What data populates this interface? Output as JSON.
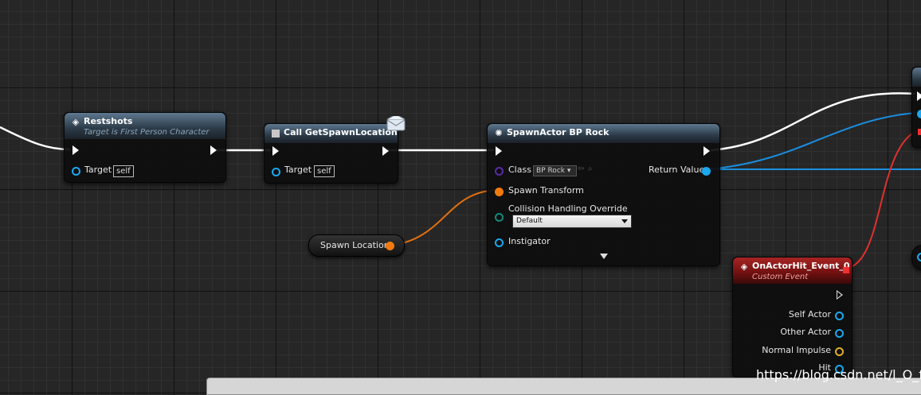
{
  "nodes": {
    "restshots": {
      "title": "Restshots",
      "subtitle": "Target is First Person Character",
      "target_label": "Target",
      "target_value": "self"
    },
    "get_spawn": {
      "title": "Call GetSpawnLocation",
      "target_label": "Target",
      "target_value": "self"
    },
    "spawn_actor": {
      "title": "SpawnActor BP Rock",
      "class_label": "Class",
      "class_value": "BP Rock",
      "spawn_transform_label": "Spawn Transform",
      "collision_label": "Collision Handling Override",
      "collision_value": "Default",
      "instigator_label": "Instigator",
      "return_label": "Return Value"
    },
    "spawn_location": {
      "label": "Spawn Location"
    },
    "on_actor_hit": {
      "title": "OnActorHit_Event_0",
      "subtitle": "Custom Event",
      "pins": [
        "Self Actor",
        "Other Actor",
        "Normal Impulse",
        "Hit"
      ]
    }
  },
  "watermark": "https://blog.csdn.net/l_O_fly",
  "colors": {
    "exec": "#ffffff",
    "object": "#1aa8f0",
    "struct": "#f07a10",
    "delegate": "#f03030",
    "event_header": "#a82424"
  }
}
